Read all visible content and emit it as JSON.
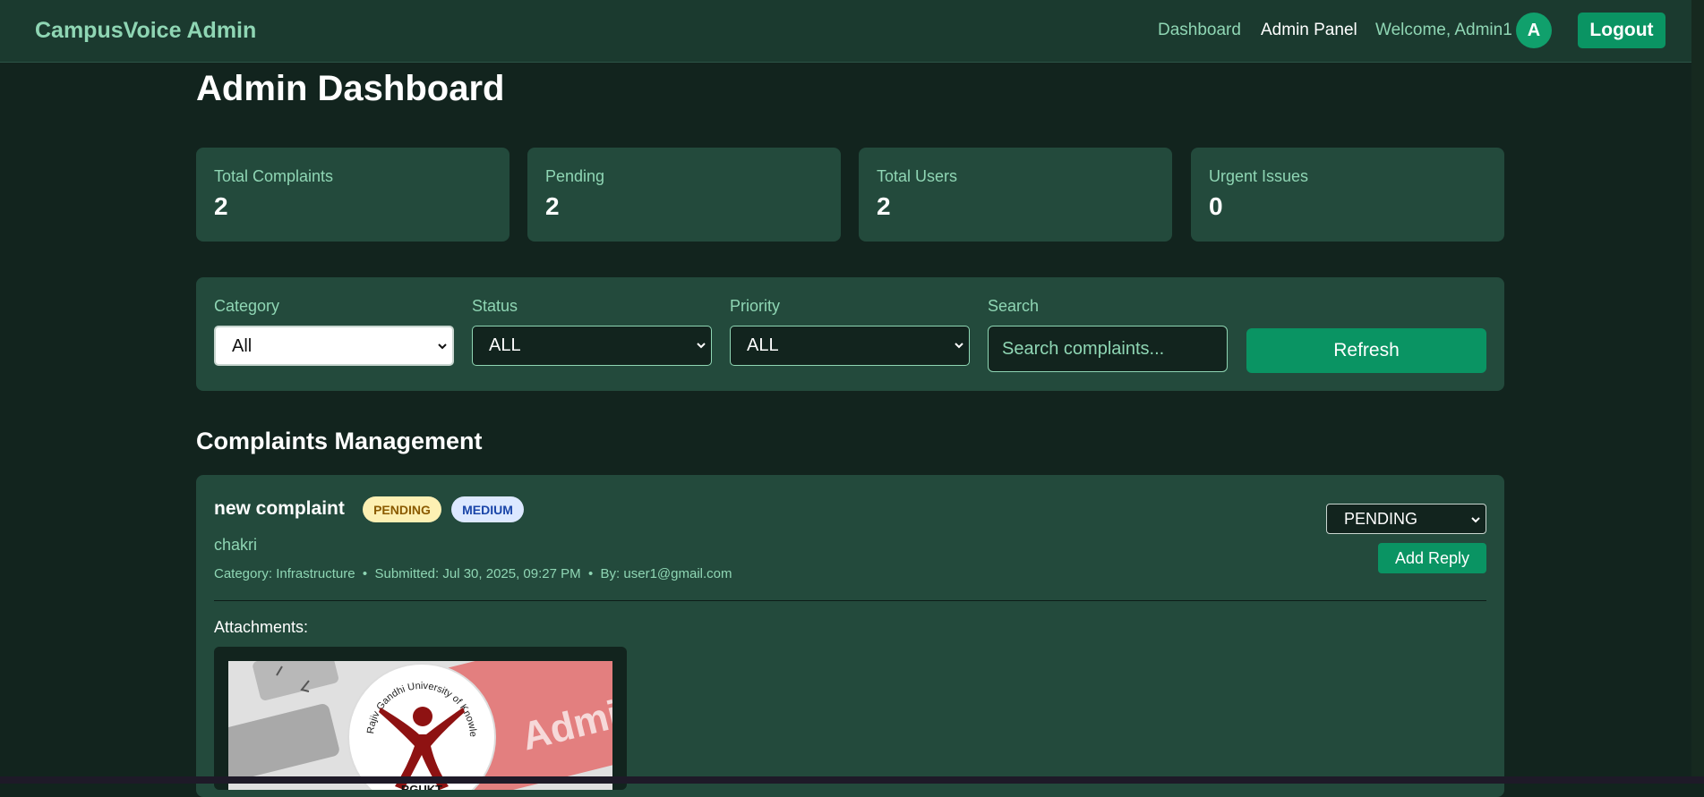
{
  "header": {
    "brand": "CampusVoice Admin",
    "nav": [
      {
        "label": "Dashboard",
        "active": false
      },
      {
        "label": "Admin Panel",
        "active": true
      }
    ],
    "welcome": "Welcome, Admin1",
    "avatar_initial": "A",
    "logout_label": "Logout"
  },
  "page_title": "Admin Dashboard",
  "stats": [
    {
      "label": "Total Complaints",
      "value": "2"
    },
    {
      "label": "Pending",
      "value": "2"
    },
    {
      "label": "Total Users",
      "value": "2"
    },
    {
      "label": "Urgent Issues",
      "value": "0"
    }
  ],
  "filters": {
    "category": {
      "label": "Category",
      "value": "All"
    },
    "status": {
      "label": "Status",
      "value": "ALL"
    },
    "priority": {
      "label": "Priority",
      "value": "ALL"
    },
    "search": {
      "label": "Search",
      "placeholder": "Search complaints..."
    },
    "refresh_label": "Refresh"
  },
  "section_title": "Complaints Management",
  "complaints": [
    {
      "title": "new complaint",
      "status_badge": "PENDING",
      "priority_badge": "MEDIUM",
      "author": "chakri",
      "meta": "Category: Infrastructure  •  Submitted: Jul 30, 2025, 09:27 PM  •  By: user1@gmail.com",
      "status_select": "PENDING",
      "reply_label": "Add Reply",
      "attachments_label": "Attachments:",
      "attachment_logo_text": "Rajiv Gandhi University of Knowledge Technologies",
      "attachment_logo_short": "RGUKT",
      "attachment_bg_word": "Admission"
    }
  ],
  "colors": {
    "background": "#12241e",
    "topbar": "#1b3a2f",
    "card": "#234a3c",
    "accent": "#0a9463",
    "muted_text": "#8fd6b4"
  }
}
